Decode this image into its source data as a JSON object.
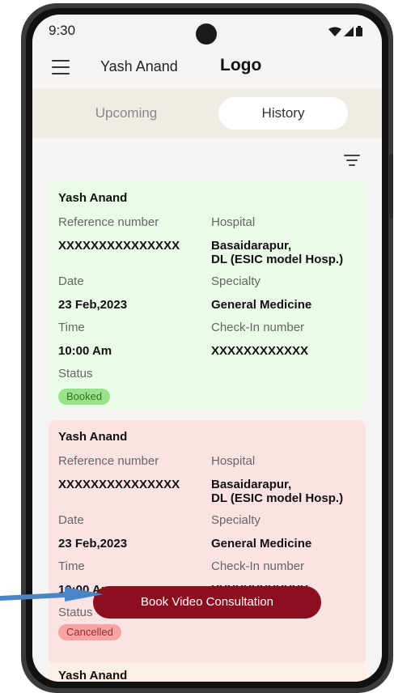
{
  "status_bar": {
    "time": "9:30"
  },
  "app_bar": {
    "user_name": "Yash Anand",
    "logo": "Logo"
  },
  "tabs": [
    {
      "label": "Upcoming",
      "active": false
    },
    {
      "label": "History",
      "active": true
    }
  ],
  "cards": [
    {
      "name": "Yash Anand",
      "reference_label": "Reference number",
      "reference_value": "XXXXXXXXXXXXXXX",
      "hospital_label": "Hospital",
      "hospital_line1": "Basaidarapur,",
      "hospital_line2": "DL (ESIC model Hosp.)",
      "date_label": "Date",
      "date_value": "23 Feb,2023",
      "specialty_label": "Specialty",
      "specialty_value": "General Medicine",
      "time_label": "Time",
      "time_value": "10:00 Am",
      "checkin_label": "Check-In number",
      "checkin_value": "XXXXXXXXXXXX",
      "status_label": "Status",
      "status_value": "Booked"
    },
    {
      "name": "Yash Anand",
      "reference_label": "Reference number",
      "reference_value": "XXXXXXXXXXXXXXX",
      "hospital_label": "Hospital",
      "hospital_line1": "Basaidarapur,",
      "hospital_line2": "DL (ESIC model Hosp.)",
      "date_label": "Date",
      "date_value": "23 Feb,2023",
      "specialty_label": "Specialty",
      "specialty_value": "General Medicine",
      "time_label": "Time",
      "time_value": "10:00 Am",
      "checkin_label": "Check-In number",
      "checkin_value": "XXXXXXXXXXXX",
      "status_label": "Status",
      "status_value": "Cancelled"
    },
    {
      "name": "Yash Anand"
    }
  ],
  "floating_button": {
    "label": "Book Video Consultation"
  },
  "colors": {
    "booked_card": "#eafbe7",
    "cancelled_card": "#fbe3e3",
    "booked_badge": "#9ae28a",
    "cancelled_badge": "#f6a3a3",
    "button": "#8b0f1e",
    "pointer": "#4a86c5"
  },
  "icons": [
    "menu-icon",
    "filter-icon",
    "wifi-icon",
    "signal-icon",
    "battery-icon",
    "arrow-icon"
  ]
}
